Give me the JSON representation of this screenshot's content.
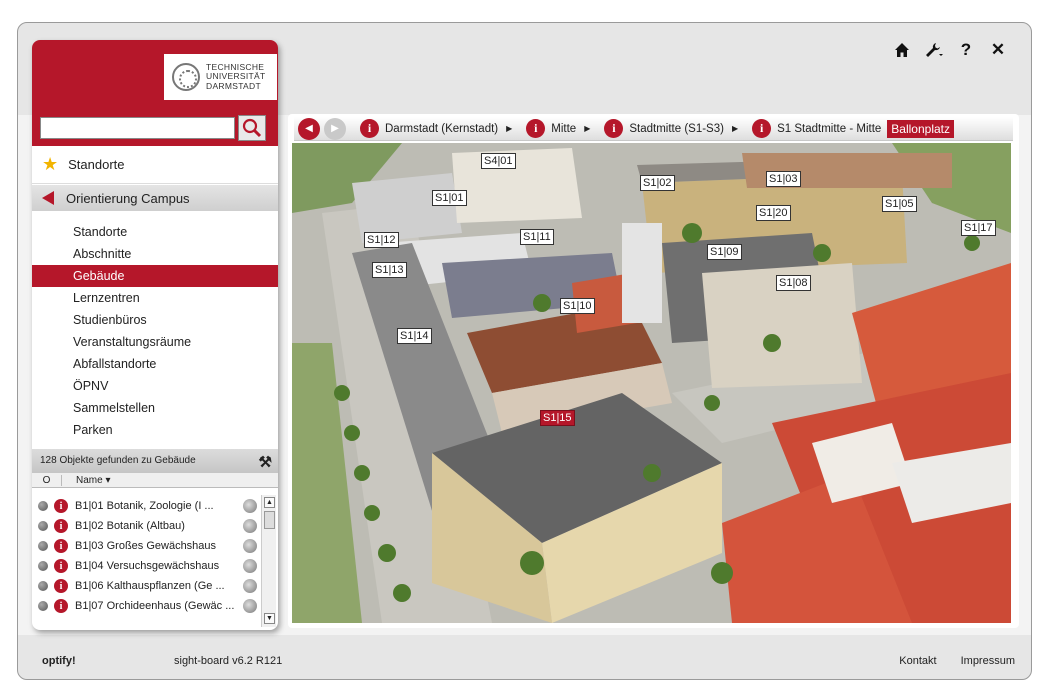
{
  "toolbar": {
    "home_icon": "home-icon",
    "tools_icon": "wrench-icon",
    "help_label": "?",
    "close_label": "✕"
  },
  "logo": {
    "line1": "TECHNISCHE",
    "line2": "UNIVERSITÄT",
    "line3": "DARMSTADT"
  },
  "search": {
    "value": "",
    "placeholder": ""
  },
  "nav": {
    "favorites_label": "Standorte",
    "back_label": "Orientierung Campus",
    "items": [
      "Standorte",
      "Abschnitte",
      "Gebäude",
      "Lernzentren",
      "Studienbüros",
      "Veranstaltungsräume",
      "Abfallstandorte",
      "ÖPNV",
      "Sammelstellen",
      "Parken"
    ],
    "active_item": "Gebäude"
  },
  "results": {
    "count_text": "128 Objekte gefunden zu Gebäude",
    "col_status": "O",
    "col_name": "Name",
    "rows": [
      "B1|01 Botanik, Zoologie (I ...",
      "B1|02 Botanik (Altbau)",
      "B1|03 Großes Gewächshaus",
      "B1|04 Versuchsgewächshaus",
      "B1|06 Kalthauspflanzen (Ge ...",
      "B1|07 Orchideenhaus (Gewäc ..."
    ]
  },
  "breadcrumb": {
    "items": [
      "Darmstadt (Kernstadt)",
      "Mitte",
      "Stadtmitte (S1-S3)",
      "S1 Stadtmitte - Mitte"
    ],
    "current": "Ballonplatz"
  },
  "map": {
    "labels": [
      "S4|01",
      "S1|01",
      "S1|02",
      "S1|03",
      "S1|20",
      "S1|05",
      "S1|17",
      "S1|12",
      "S1|11",
      "S1|09",
      "S1|13",
      "S1|08",
      "S1|10",
      "S1|14",
      "S1|15"
    ],
    "selected": "S1|15"
  },
  "footer": {
    "brand": "optify!",
    "version": "sight-board v6.2 R121",
    "link_contact": "Kontakt",
    "link_imprint": "Impressum"
  },
  "colors": {
    "accent": "#b5172a",
    "frame_bg": "#e6e6e6"
  }
}
